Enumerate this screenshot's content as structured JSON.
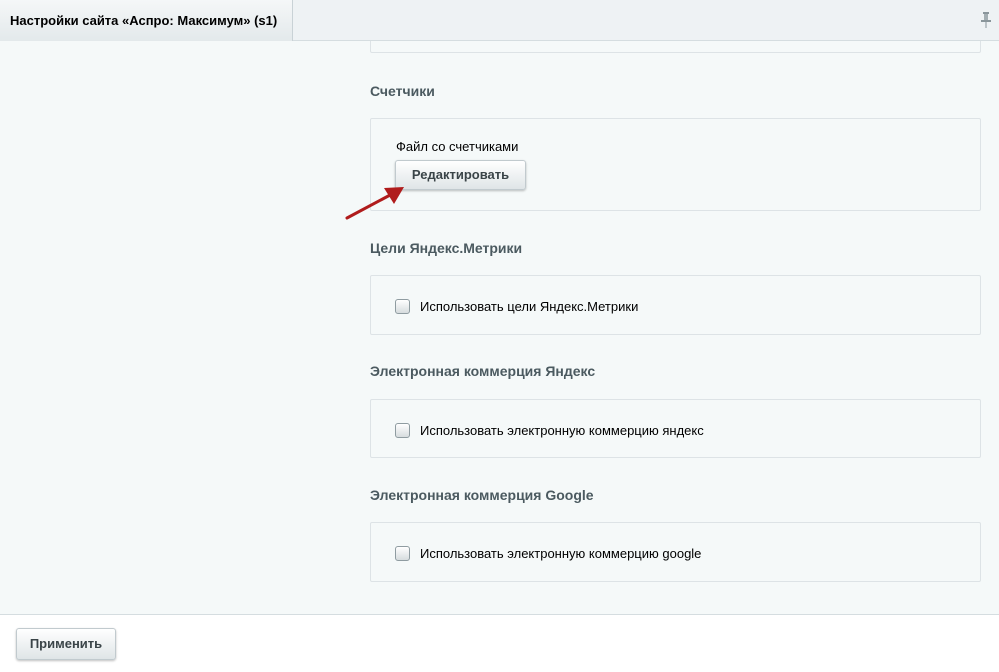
{
  "header": {
    "tab_title": "Настройки сайта «Аспро: Максимум» (s1)",
    "pin_icon": "pin-icon"
  },
  "sections": {
    "counters": {
      "title": "Счетчики",
      "file_label": "Файл со счетчиками",
      "edit_button": "Редактировать"
    },
    "yandex_goals": {
      "title": "Цели Яндекс.Метрики",
      "checkbox_label": "Использовать цели Яндекс.Метрики",
      "checked": false
    },
    "yandex_ecommerce": {
      "title": "Электронная коммерция Яндекс",
      "checkbox_label": "Использовать электронную коммерцию яндекс",
      "checked": false
    },
    "google_ecommerce": {
      "title": "Электронная коммерция Google",
      "checkbox_label": "Использовать электронную коммерцию google",
      "checked": false
    }
  },
  "footer": {
    "apply_button": "Применить"
  },
  "colors": {
    "section_title": "#4b5a60",
    "annotation_arrow": "#b01c1c",
    "background": "#f5f9f9"
  }
}
